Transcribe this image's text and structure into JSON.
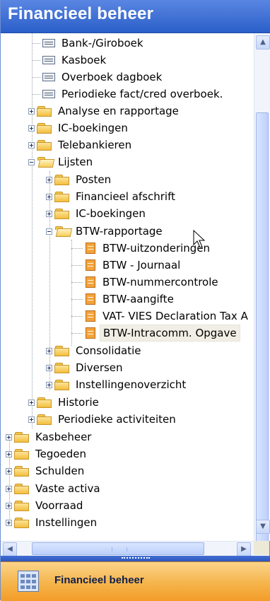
{
  "header": {
    "title": "Financieel beheer"
  },
  "tree": {
    "items": [
      {
        "label": "Bank-/Giroboek",
        "icon": "journal-icon"
      },
      {
        "label": "Kasboek",
        "icon": "journal-icon"
      },
      {
        "label": "Overboek dagboek",
        "icon": "journal-icon"
      },
      {
        "label": "Periodieke fact/cred overboek.",
        "icon": "journal-icon"
      },
      {
        "label": "Analyse en rapportage",
        "icon": "folder-icon",
        "expander": "plus"
      },
      {
        "label": "IC-boekingen",
        "icon": "folder-icon",
        "expander": "plus"
      },
      {
        "label": "Telebankieren",
        "icon": "folder-icon",
        "expander": "plus"
      },
      {
        "label": "Lijsten",
        "icon": "folder-open-icon",
        "expander": "minus"
      },
      {
        "label": "Posten",
        "icon": "folder-icon",
        "expander": "plus"
      },
      {
        "label": "Financieel afschrift",
        "icon": "folder-icon",
        "expander": "plus"
      },
      {
        "label": "IC-boekingen",
        "icon": "folder-icon",
        "expander": "plus"
      },
      {
        "label": "BTW-rapportage",
        "icon": "folder-open-icon",
        "expander": "minus"
      },
      {
        "label": "BTW-uitzonderingen",
        "icon": "report-icon"
      },
      {
        "label": "BTW - Journaal",
        "icon": "report-icon"
      },
      {
        "label": "BTW-nummercontrole",
        "icon": "report-icon"
      },
      {
        "label": "BTW-aangifte",
        "icon": "report-icon"
      },
      {
        "label": "VAT- VIES Declaration Tax A",
        "icon": "report-icon"
      },
      {
        "label": "BTW-Intracomm. Opgave",
        "icon": "report-icon",
        "selected": true
      },
      {
        "label": "Consolidatie",
        "icon": "folder-icon",
        "expander": "plus"
      },
      {
        "label": "Diversen",
        "icon": "folder-icon",
        "expander": "plus"
      },
      {
        "label": "Instellingenoverzicht",
        "icon": "folder-icon",
        "expander": "plus"
      },
      {
        "label": "Historie",
        "icon": "folder-icon",
        "expander": "plus"
      },
      {
        "label": "Periodieke activiteiten",
        "icon": "folder-icon",
        "expander": "plus"
      },
      {
        "label": "Kasbeheer",
        "icon": "folder-icon",
        "expander": "plus"
      },
      {
        "label": "Tegoeden",
        "icon": "folder-icon",
        "expander": "plus"
      },
      {
        "label": "Schulden",
        "icon": "folder-icon",
        "expander": "plus"
      },
      {
        "label": "Vaste activa",
        "icon": "folder-icon",
        "expander": "plus"
      },
      {
        "label": "Voorraad",
        "icon": "folder-icon",
        "expander": "plus"
      },
      {
        "label": "Instellingen",
        "icon": "folder-icon",
        "expander": "plus"
      }
    ]
  },
  "navigation": {
    "button_label": "Financieel beheer",
    "icon": "ledger-icon"
  },
  "colors": {
    "header": "#2a5fc9",
    "nav_button": "#f5b44b",
    "selected_row": "#f1efe5"
  }
}
